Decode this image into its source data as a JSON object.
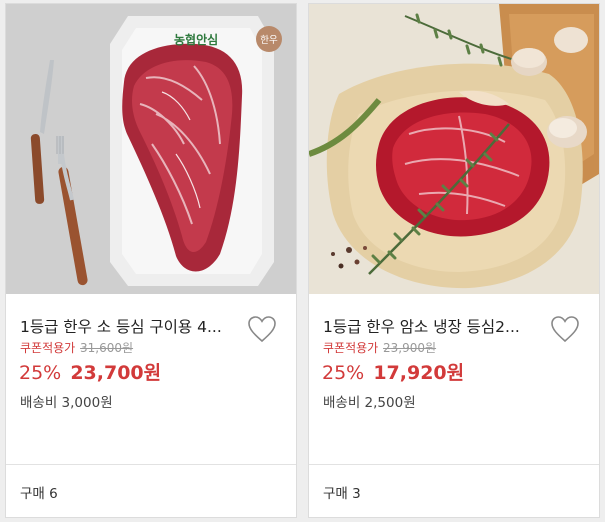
{
  "products": [
    {
      "title": "1등급 한우 소 등심 구이용 4...",
      "logo_text": "농협안심",
      "logo_badge": "한우",
      "coupon_label": "쿠폰적용가",
      "original_price": "31,600원",
      "discount": "25%",
      "sale_price": "23,700원",
      "shipping": "배송비 3,000원",
      "buy_count": "구매 6",
      "colors": {
        "accent": "#d23a3a"
      }
    },
    {
      "title": "1등급 한우 암소 냉장 등심2...",
      "coupon_label": "쿠폰적용가",
      "original_price": "23,900원",
      "discount": "25%",
      "sale_price": "17,920원",
      "shipping": "배송비 2,500원",
      "buy_count": "구매 3",
      "colors": {
        "accent": "#d23a3a"
      }
    }
  ]
}
